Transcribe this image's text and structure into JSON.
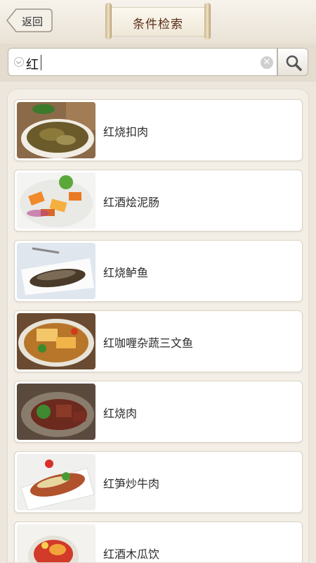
{
  "header": {
    "back_label": "返回",
    "title": "条件检索"
  },
  "search": {
    "query": "红",
    "clear_icon": "clear-icon",
    "search_icon": "magnifier-icon"
  },
  "results": [
    {
      "name": "红烧扣肉",
      "thumb": "braised-pork-with-greens-photo"
    },
    {
      "name": "红酒烩泥肠",
      "thumb": "wine-sausage-stew-photo"
    },
    {
      "name": "红烧鲈鱼",
      "thumb": "braised-perch-photo"
    },
    {
      "name": "红咖喱杂蔬三文鱼",
      "thumb": "curry-salmon-veg-photo"
    },
    {
      "name": "红烧肉",
      "thumb": "braised-pork-belly-photo"
    },
    {
      "name": "红笋炒牛肉",
      "thumb": "stir-fried-beef-photo"
    },
    {
      "name": "红酒木瓜饮",
      "thumb": "papaya-wine-drink-photo"
    }
  ],
  "colors": {
    "title_text": "#5a2e1a",
    "background": "#ece6dc"
  }
}
